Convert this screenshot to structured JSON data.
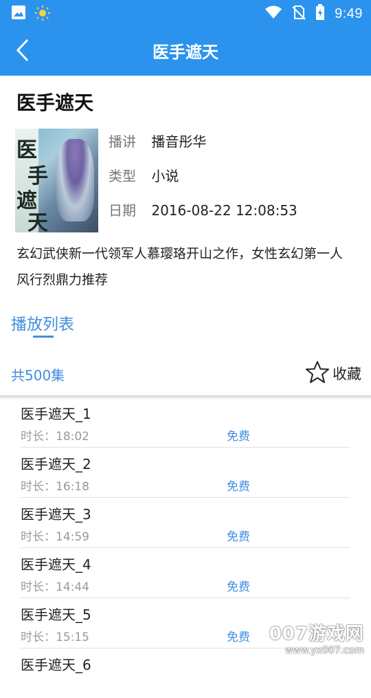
{
  "status_bar": {
    "time": "9:49",
    "icons": [
      "image-icon",
      "sun-icon",
      "wifi-icon",
      "no-sim-icon",
      "battery-charging-icon"
    ]
  },
  "header": {
    "title": "医手遮天",
    "back_icon": "chevron-left-icon"
  },
  "book": {
    "title": "医手遮天",
    "cover_text": [
      "医",
      "手",
      "遮",
      "天"
    ],
    "meta": [
      {
        "key": "播讲",
        "value": "播音彤华"
      },
      {
        "key": "类型",
        "value": "小说"
      },
      {
        "key": "日期",
        "value": "2016-08-22 12:08:53"
      }
    ],
    "description": "玄幻武侠新一代领军人慕璎珞开山之作，女性玄幻第一人风行烈鼎力推荐"
  },
  "tabs": {
    "active_label": "播放列表"
  },
  "playlist": {
    "count_label": "共500集",
    "favorite_label": "收藏",
    "items": [
      {
        "name": "医手遮天_1",
        "duration": "时长：18:02",
        "price": "免费"
      },
      {
        "name": "医手遮天_2",
        "duration": "时长：16:18",
        "price": "免费"
      },
      {
        "name": "医手遮天_3",
        "duration": "时长：14:59",
        "price": "免费"
      },
      {
        "name": "医手遮天_4",
        "duration": "时长：14:44",
        "price": "免费"
      },
      {
        "name": "医手遮天_5",
        "duration": "时长：15:15",
        "price": "免费"
      },
      {
        "name": "医手遮天_6",
        "duration": "",
        "price": ""
      }
    ]
  },
  "watermark": {
    "line1": "007游戏网",
    "line2": "www.yx007.com"
  },
  "colors": {
    "primary": "#2b93ee",
    "accent_text": "#3f8ede"
  }
}
